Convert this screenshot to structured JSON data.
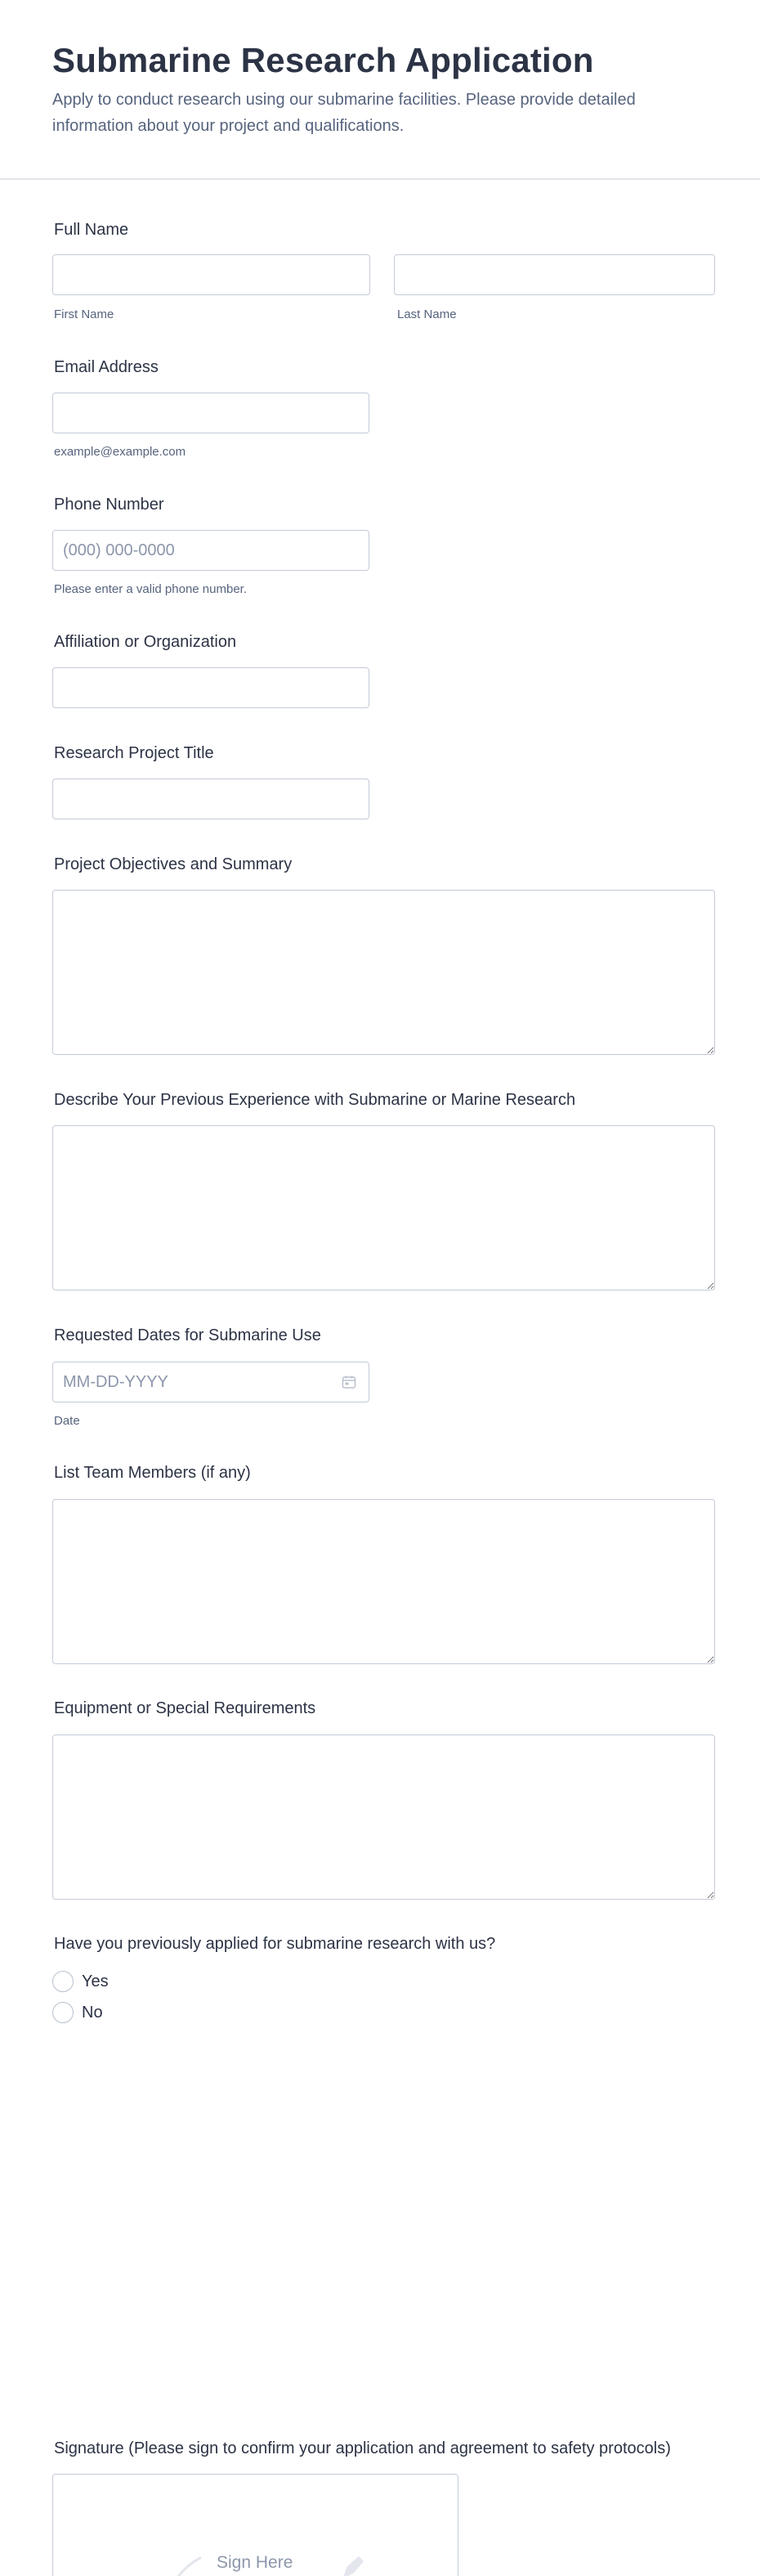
{
  "header": {
    "title": "Submarine Research Application",
    "subtitle": "Apply to conduct research using our submarine facilities. Please provide detailed information about your project and qualifications."
  },
  "fields": {
    "full_name": {
      "label": "Full Name",
      "first_sublabel": "First Name",
      "last_sublabel": "Last Name",
      "first_value": "",
      "last_value": ""
    },
    "email": {
      "label": "Email Address",
      "sublabel": "example@example.com",
      "value": ""
    },
    "phone": {
      "label": "Phone Number",
      "placeholder": "(000) 000-0000",
      "sublabel": "Please enter a valid phone number.",
      "value": ""
    },
    "affiliation": {
      "label": "Affiliation or Organization",
      "value": ""
    },
    "project_title": {
      "label": "Research Project Title",
      "value": ""
    },
    "objectives": {
      "label": "Project Objectives and Summary",
      "value": ""
    },
    "experience": {
      "label": "Describe Your Previous Experience with Submarine or Marine Research",
      "value": ""
    },
    "dates": {
      "label": "Requested Dates for Submarine Use",
      "placeholder": "MM-DD-YYYY",
      "sublabel": "Date",
      "icon": "calendar-icon"
    },
    "team": {
      "label": "List Team Members (if any)",
      "value": ""
    },
    "equipment": {
      "label": "Equipment or Special Requirements",
      "value": ""
    },
    "previous_application": {
      "label": "Have you previously applied for submarine research with us?",
      "options": [
        "Yes",
        "No"
      ]
    },
    "signature": {
      "label": "Signature (Please sign to confirm your application and agreement to safety protocols)",
      "placeholder": "Sign Here",
      "icon": "pen-icon"
    }
  },
  "colors": {
    "text": "#2c3345",
    "muted": "#57647e",
    "border": "#c3cad8",
    "placeholder": "#8c96ab"
  }
}
